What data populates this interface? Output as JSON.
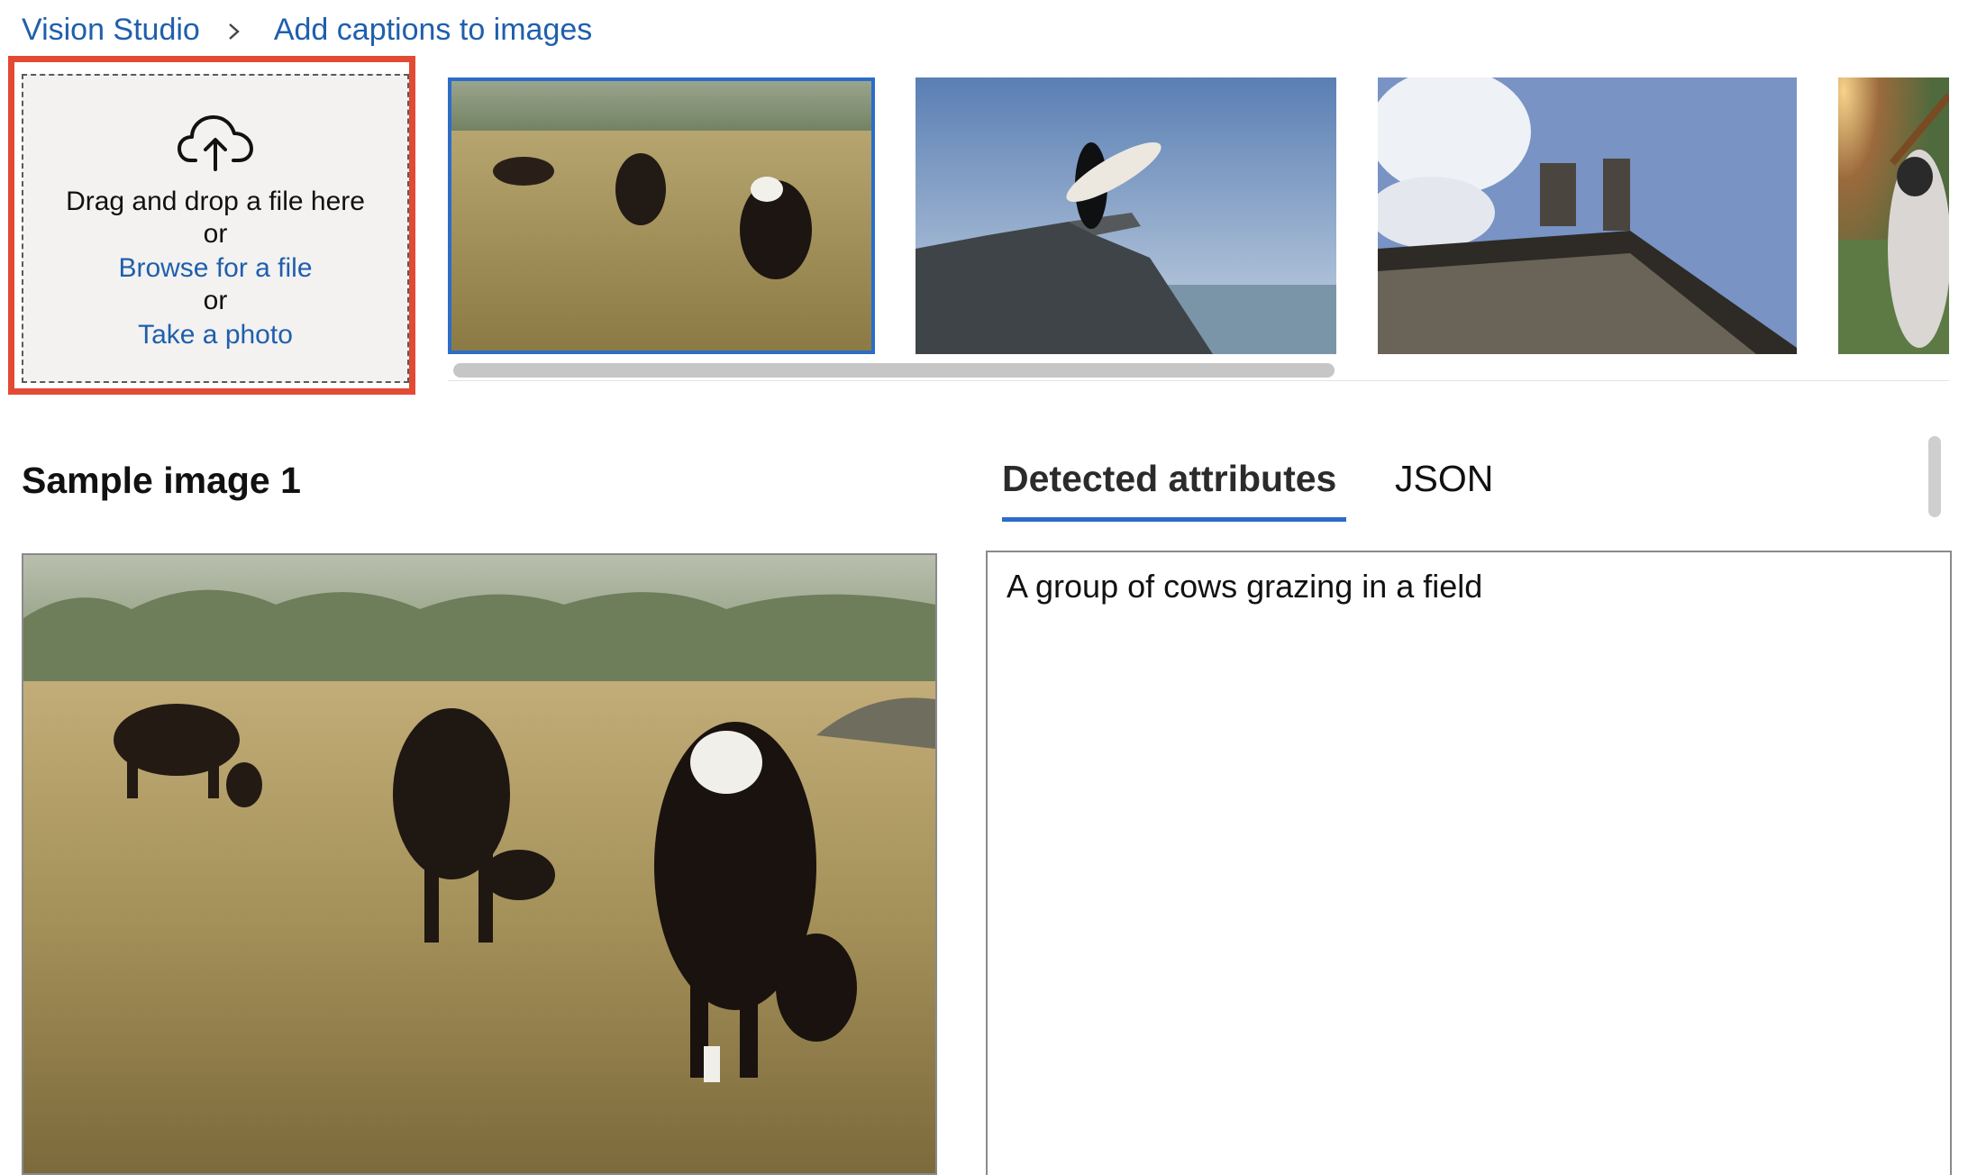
{
  "breadcrumb": {
    "root": "Vision Studio",
    "current": "Add captions to images"
  },
  "upload": {
    "drag_text": "Drag and drop a file here",
    "or_1": "or",
    "browse_label": "Browse for a file",
    "or_2": "or",
    "photo_label": "Take a photo"
  },
  "gallery": {
    "thumbnails": [
      "cows-grazing",
      "surfer-on-rock",
      "building-statues",
      "baseball-batter"
    ],
    "selected_index": 0
  },
  "sample": {
    "title": "Sample image 1"
  },
  "tabs": {
    "detected": "Detected attributes",
    "json": "JSON"
  },
  "result": {
    "caption": "A group of cows grazing in a field"
  },
  "colors": {
    "accent": "#2b6dc9",
    "highlight": "#e24a33",
    "link": "#1f5fad"
  }
}
